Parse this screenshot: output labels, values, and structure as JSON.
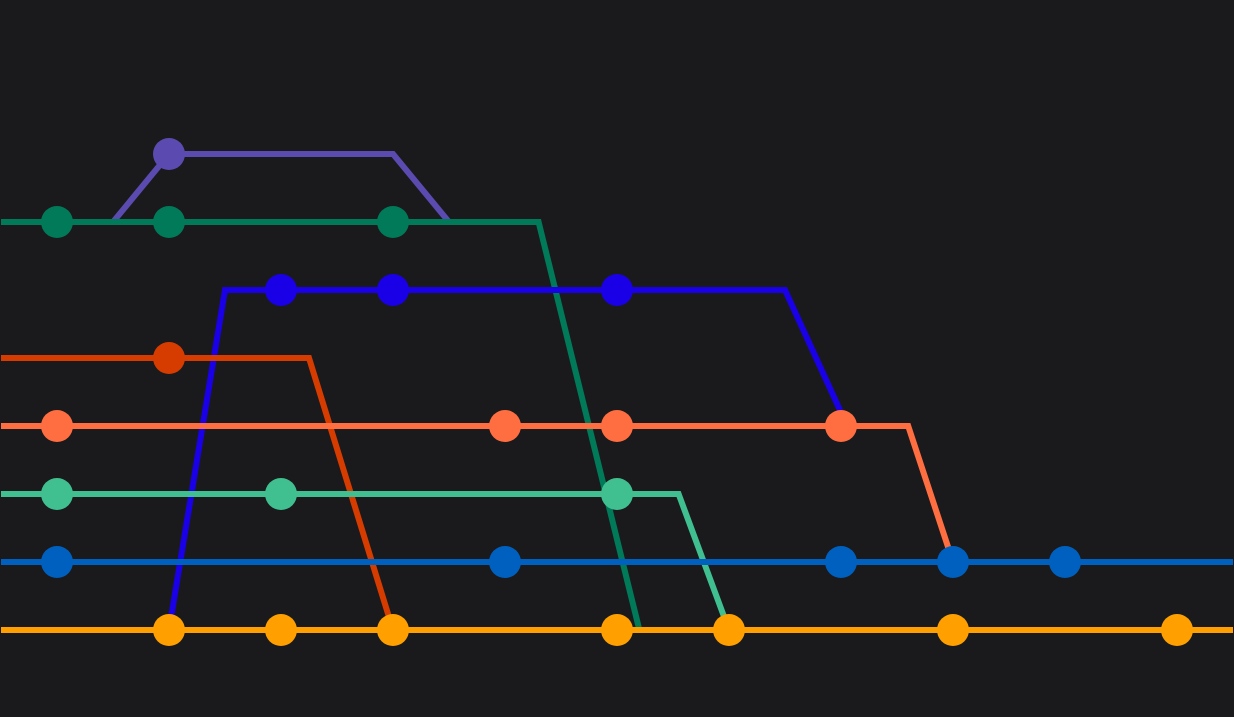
{
  "canvas": {
    "background": "#1a1a1d"
  },
  "colors": {
    "purple": "#5b4bb0",
    "darkgreen": "#007a58",
    "blue": "#1a00e6",
    "red": "#d63c00",
    "coral": "#ff6e40",
    "mint": "#40c090",
    "midblue": "#0060c0",
    "yellow": "#ffa000"
  },
  "lines": [
    {
      "id": "purple",
      "color": "purple",
      "path": [
        [
          0.5,
          1
        ],
        [
          1,
          0
        ],
        [
          3,
          0
        ],
        [
          3.5,
          1
        ]
      ]
    },
    {
      "id": "darkgreen",
      "color": "darkgreen",
      "path": [
        [
          -0.5,
          1
        ],
        [
          4.3,
          1
        ],
        [
          5.2,
          7
        ]
      ]
    },
    {
      "id": "blue",
      "color": "blue",
      "path": [
        [
          1,
          7
        ],
        [
          1.5,
          2
        ],
        [
          6.5,
          2
        ],
        [
          7,
          3.8
        ]
      ]
    },
    {
      "id": "red",
      "color": "red",
      "path": [
        [
          -0.5,
          3
        ],
        [
          2.25,
          3
        ],
        [
          3,
          7
        ]
      ]
    },
    {
      "id": "coral",
      "color": "coral",
      "path": [
        [
          -0.5,
          4
        ],
        [
          7.6,
          4
        ],
        [
          8,
          6
        ]
      ]
    },
    {
      "id": "mint",
      "color": "mint",
      "path": [
        [
          -0.5,
          5
        ],
        [
          5.55,
          5
        ],
        [
          6,
          7
        ]
      ]
    },
    {
      "id": "midblue",
      "color": "midblue",
      "path": [
        [
          -0.5,
          6
        ],
        [
          10.5,
          6
        ]
      ]
    },
    {
      "id": "yellow",
      "color": "yellow",
      "path": [
        [
          -0.5,
          7
        ],
        [
          10.5,
          7
        ]
      ]
    }
  ],
  "commits": [
    {
      "lane": 0,
      "col": 1,
      "color": "purple"
    },
    {
      "lane": 1,
      "col": 0,
      "color": "darkgreen"
    },
    {
      "lane": 1,
      "col": 1,
      "color": "darkgreen"
    },
    {
      "lane": 1,
      "col": 3,
      "color": "darkgreen"
    },
    {
      "lane": 2,
      "col": 2,
      "color": "blue"
    },
    {
      "lane": 2,
      "col": 3,
      "color": "blue"
    },
    {
      "lane": 2,
      "col": 5,
      "color": "blue"
    },
    {
      "lane": 3,
      "col": 1,
      "color": "red"
    },
    {
      "lane": 4,
      "col": 0,
      "color": "coral"
    },
    {
      "lane": 4,
      "col": 4,
      "color": "coral"
    },
    {
      "lane": 4,
      "col": 5,
      "color": "coral"
    },
    {
      "lane": 4,
      "col": 7,
      "color": "coral"
    },
    {
      "lane": 5,
      "col": 0,
      "color": "mint"
    },
    {
      "lane": 5,
      "col": 2,
      "color": "mint"
    },
    {
      "lane": 5,
      "col": 5,
      "color": "mint"
    },
    {
      "lane": 6,
      "col": 0,
      "color": "midblue"
    },
    {
      "lane": 6,
      "col": 4,
      "color": "midblue"
    },
    {
      "lane": 6,
      "col": 7,
      "color": "midblue"
    },
    {
      "lane": 6,
      "col": 8,
      "color": "midblue"
    },
    {
      "lane": 6,
      "col": 9,
      "color": "midblue"
    },
    {
      "lane": 7,
      "col": 1,
      "color": "yellow"
    },
    {
      "lane": 7,
      "col": 2,
      "color": "yellow"
    },
    {
      "lane": 7,
      "col": 3,
      "color": "yellow"
    },
    {
      "lane": 7,
      "col": 5,
      "color": "yellow"
    },
    {
      "lane": 7,
      "col": 6,
      "color": "yellow"
    },
    {
      "lane": 7,
      "col": 8,
      "color": "yellow"
    },
    {
      "lane": 7,
      "col": 10,
      "color": "yellow"
    }
  ]
}
